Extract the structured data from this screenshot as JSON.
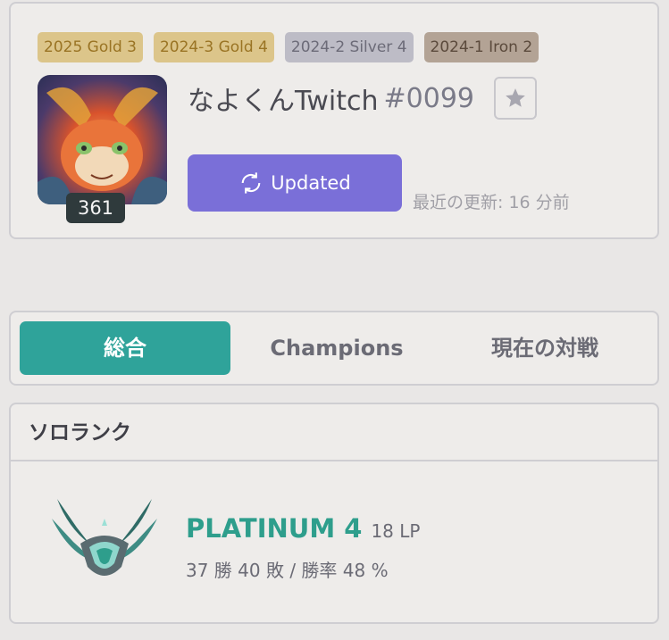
{
  "profile": {
    "badges": [
      {
        "label": "2025  Gold 3",
        "tier": "gold"
      },
      {
        "label": "2024-3  Gold 4",
        "tier": "gold"
      },
      {
        "label": "2024-2  Silver 4",
        "tier": "silver"
      },
      {
        "label": "2024-1  Iron 2",
        "tier": "iron"
      }
    ],
    "level": "361",
    "name": "なよくんTwitch",
    "tag": "#0099",
    "update_button": "Updated",
    "last_update": "最近の更新: 16 分前"
  },
  "tabs": {
    "overview": "総合",
    "champions": "Champions",
    "live_game": "現在の対戦"
  },
  "rank": {
    "queue_title": "ソロランク",
    "tier": "PLATINUM 4",
    "lp": "18 LP",
    "record": "37 勝 40 敗 / 勝率 48 %"
  },
  "colors": {
    "accent_teal": "#2fa39a",
    "button_purple": "#7a6fd8",
    "tier_text": "#2e9e8c"
  },
  "icons": {
    "update": "refresh-icon",
    "favorite": "star-icon",
    "rank_emblem": "platinum-emblem-icon"
  }
}
